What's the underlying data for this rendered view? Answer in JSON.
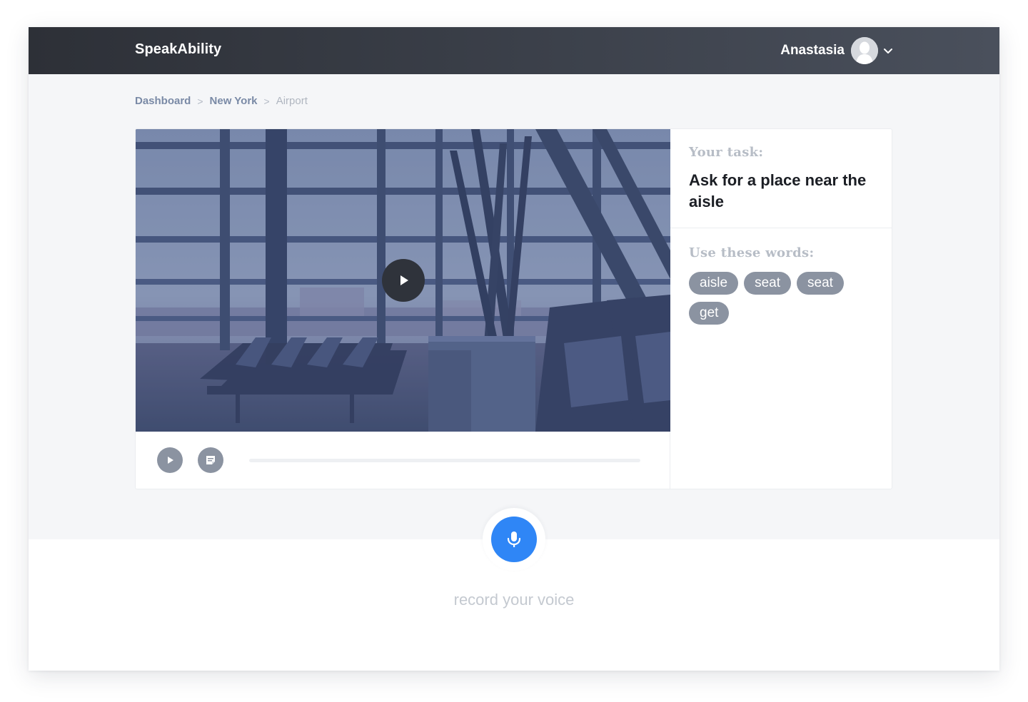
{
  "app": {
    "brand": "SpeakAbility"
  },
  "user": {
    "name": "Anastasia",
    "avatar_icon": "user-avatar-icon",
    "menu_icon": "chevron-down-icon"
  },
  "breadcrumb": {
    "items": [
      {
        "label": "Dashboard",
        "link": true
      },
      {
        "label": "New York",
        "link": true
      },
      {
        "label": "Airport",
        "link": false
      }
    ],
    "separator": ">"
  },
  "video": {
    "play_icon": "play-icon",
    "controls": {
      "play_icon": "play-icon",
      "notes_icon": "notes-icon"
    },
    "progress": 0.0
  },
  "task": {
    "label": "Your task:",
    "text": "Ask for a place near the aisle"
  },
  "words": {
    "label": "Use these words:",
    "items": [
      "aisle",
      "seat",
      "seat",
      "get"
    ]
  },
  "record": {
    "label": "record your voice",
    "icon": "microphone-icon"
  },
  "colors": {
    "topbar": "#2d3037",
    "accent": "#2f86f6",
    "chip": "#8b93a1",
    "link": "#7a8aa6"
  }
}
